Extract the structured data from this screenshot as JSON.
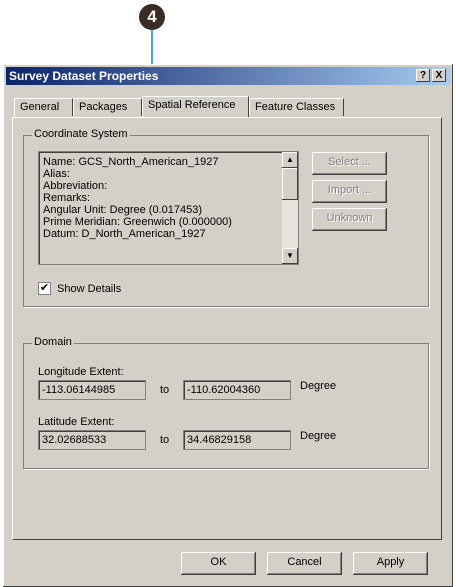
{
  "callout": {
    "number": "4"
  },
  "window": {
    "title": "Survey Dataset Properties",
    "help_label": "?",
    "close_label": "X"
  },
  "tabs": [
    "General",
    "Packages",
    "Spatial Reference",
    "Feature Classes"
  ],
  "active_tab": "Spatial Reference",
  "coordinate_system": {
    "legend": "Coordinate System",
    "details": "Name: GCS_North_American_1927\nAlias:\nAbbreviation:\nRemarks:\nAngular Unit: Degree (0.017453)\nPrime Meridian: Greenwich (0.000000)\nDatum: D_North_American_1927",
    "buttons": {
      "select": "Select ...",
      "import": "Import ...",
      "unknown": "Unknown"
    },
    "show_details_label": "Show Details",
    "show_details_checked": true,
    "check_mark": "✔"
  },
  "domain": {
    "legend": "Domain",
    "longitude": {
      "label": "Longitude Extent:",
      "min": "-113.06144985",
      "to": "to",
      "max": "-110.62004360",
      "unit": "Degree"
    },
    "latitude": {
      "label": "Latitude Extent:",
      "min": "32.02688533",
      "to": "to",
      "max": "34.46829158",
      "unit": "Degree"
    }
  },
  "footer": {
    "ok": "OK",
    "cancel": "Cancel",
    "apply": "Apply"
  }
}
